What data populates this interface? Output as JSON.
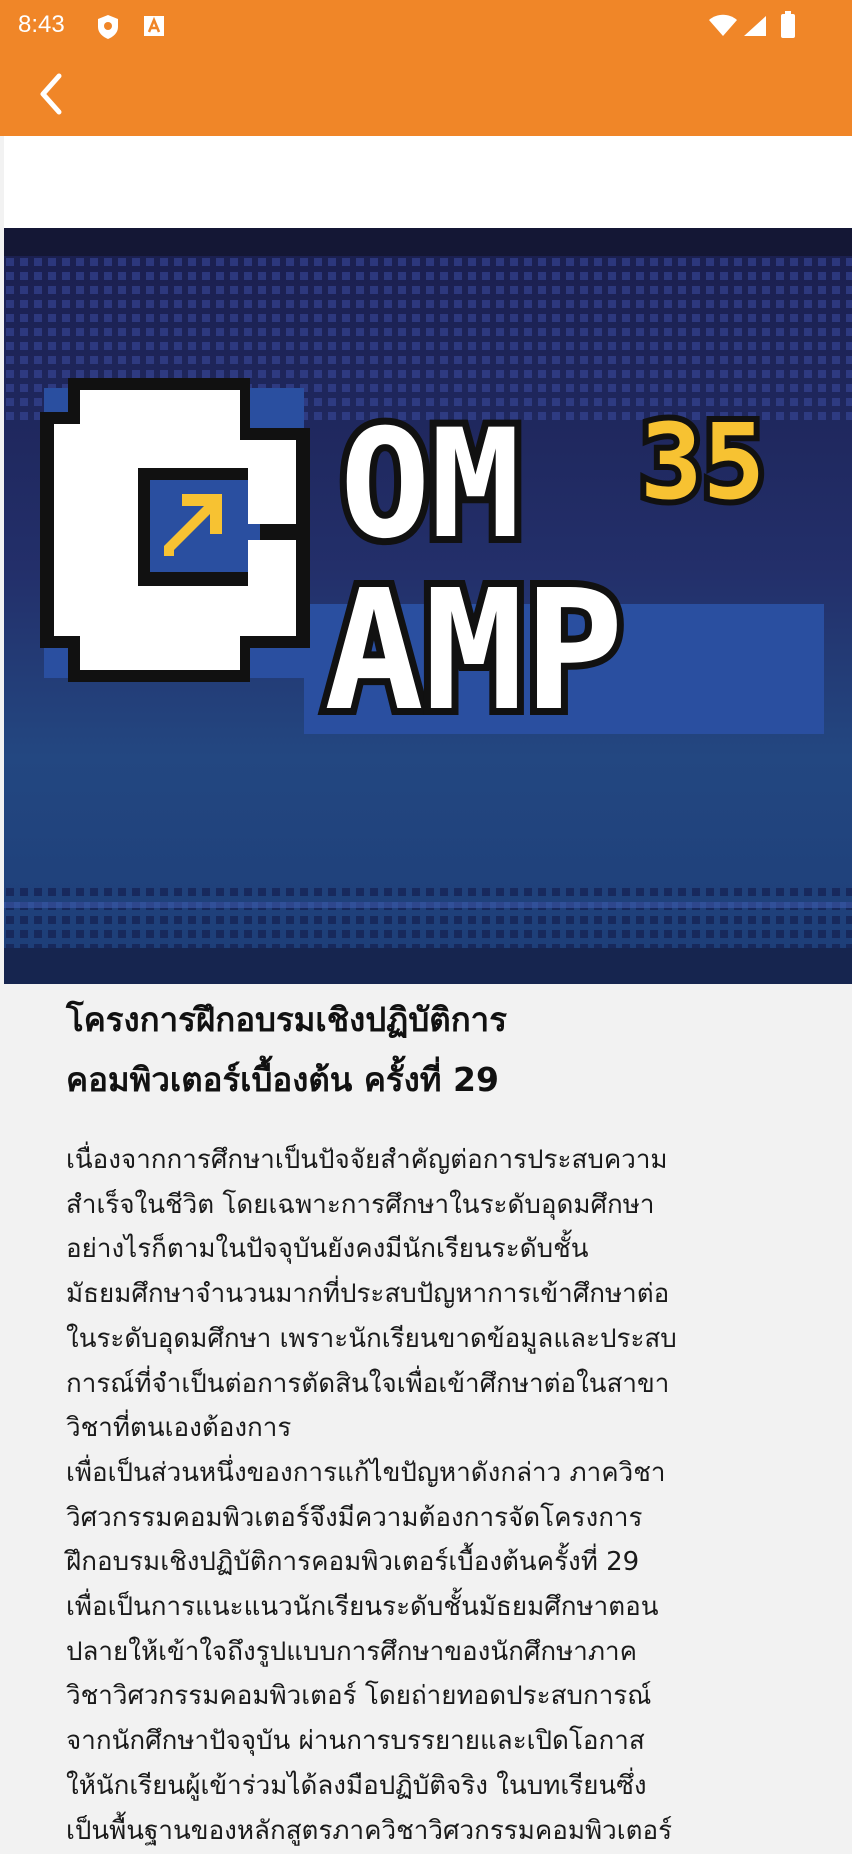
{
  "status_bar": {
    "time": "8:43",
    "icons": [
      "shield-icon",
      "a-badge-icon",
      "wifi-icon",
      "signal-icon",
      "battery-icon"
    ]
  },
  "app_bar": {
    "back_icon": "chevron-left-icon",
    "color": "#f08628"
  },
  "banner": {
    "logo_line1": "COM",
    "logo_badge": "35",
    "logo_line2": "CAMP",
    "colors": {
      "navy": "#1b2256",
      "blue": "#27478a",
      "yellow": "#f7c232",
      "white": "#ffffff"
    }
  },
  "article": {
    "title_lines": [
      "โครงการฝึกอบรมเชิงปฏิบัติการ",
      "คอมพิวเตอร์เบื้องต้น ครั้งที่ 29"
    ],
    "body_lines": [
      "เนื่องจากการศึกษาเป็นปัจจัยสำคัญต่อการประสบความ",
      "สำเร็จในชีวิต โดยเฉพาะการศึกษาในระดับอุดมศึกษา",
      "อย่างไรก็ตามในปัจจุบันยังคงมีนักเรียนระดับชั้น",
      "มัธยมศึกษาจำนวนมากที่ประสบปัญหาการเข้าศึกษาต่อ",
      "ในระดับอุดมศึกษา เพราะนักเรียนขาดข้อมูลและประสบ",
      "การณ์ที่จำเป็นต่อการตัดสินใจเพื่อเข้าศึกษาต่อในสาขา",
      "วิชาที่ตนเองต้องการ",
      "เพื่อเป็นส่วนหนึ่งของการแก้ไขปัญหาดังกล่าว ภาควิชา",
      "วิศวกรรมคอมพิวเตอร์จึงมีความต้องการจัดโครงการ",
      "ฝึกอบรมเชิงปฏิบัติการคอมพิวเตอร์เบื้องต้นครั้งที่ 29",
      "เพื่อเป็นการแนะแนวนักเรียนระดับชั้นมัธยมศึกษาตอน",
      "ปลายให้เข้าใจถึงรูปแบบการศึกษาของนักศึกษาภาค",
      "วิชาวิศวกรรมคอมพิวเตอร์ โดยถ่ายทอดประสบการณ์",
      "จากนักศึกษาปัจจุบัน ผ่านการบรรยายและเปิดโอกาส",
      "ให้นักเรียนผู้เข้าร่วมได้ลงมือปฏิบัติจริง ในบทเรียนซึ่ง",
      "เป็นพื้นฐานของหลักสูตรภาควิชาวิศวกรรมคอมพิวเตอร์"
    ]
  }
}
